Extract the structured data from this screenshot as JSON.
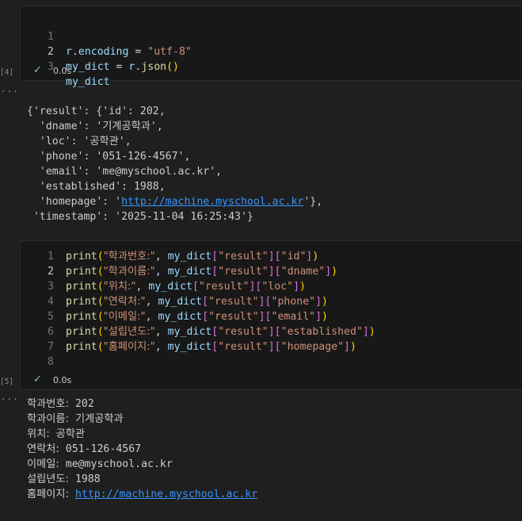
{
  "cell1": {
    "lines": [
      [
        "1",
        "r.encoding = ",
        "\"utf-8\""
      ],
      [
        "2",
        "my_dict = r.json()"
      ],
      [
        "3",
        "my_dict"
      ]
    ],
    "exec_label": "[4]",
    "time": "0.0s"
  },
  "output1": {
    "line1_prefix": "{'result': {'id': 202,",
    "line2": "  'dname': '기계공학과',",
    "line3": "  'loc': '공학관',",
    "line4": "  'phone': '051-126-4567',",
    "line5": "  'email': 'me@myschool.ac.kr',",
    "line6": "  'established': 1988,",
    "line7_prefix": "  'homepage': '",
    "line7_link": "http://machine.myschool.ac.kr",
    "line7_suffix": "'},",
    "line8": " 'timestamp': '2025-11-04 16:25:43'}"
  },
  "cell2": {
    "exec_label": "[5]",
    "time": "0.0s",
    "lines": [
      {
        "n": "1",
        "label": "\"학과번호:\"",
        "key": "\"id\""
      },
      {
        "n": "2",
        "label": "\"학과이름:\"",
        "key": "\"dname\""
      },
      {
        "n": "3",
        "label": "\"위치:\"",
        "key": "\"loc\""
      },
      {
        "n": "4",
        "label": "\"연락처:\"",
        "key": "\"phone\""
      },
      {
        "n": "5",
        "label": "\"이메일:\"",
        "key": "\"email\""
      },
      {
        "n": "6",
        "label": "\"설립년도:\"",
        "key": "\"established\""
      },
      {
        "n": "7",
        "label": "\"홈페이지:\"",
        "key": "\"homepage\""
      },
      {
        "n": "8"
      }
    ],
    "print_fn": "print",
    "var": "my_dict",
    "result_key": "\"result\""
  },
  "output2": {
    "rows": [
      {
        "label": "학과번호:",
        "value": "202"
      },
      {
        "label": "학과이름:",
        "value": "기계공학과"
      },
      {
        "label": "위치:",
        "value": "공학관"
      },
      {
        "label": "연락처:",
        "value": "051-126-4567"
      },
      {
        "label": "이메일:",
        "value": "me@myschool.ac.kr"
      },
      {
        "label": "설립년도:",
        "value": "1988"
      },
      {
        "label": "홈페이지:",
        "value": "http://machine.myschool.ac.kr"
      }
    ]
  },
  "icons": {
    "check": "checkmark-icon",
    "more": "ellipsis-icon"
  },
  "colors": {
    "bg": "#1f1f1f",
    "cell": "#181818",
    "check": "#89d185",
    "link": "#3794ff"
  }
}
